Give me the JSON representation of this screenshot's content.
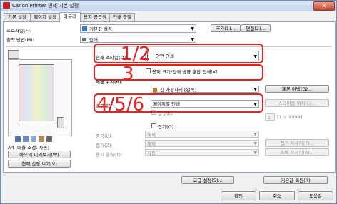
{
  "window": {
    "title": "Canon Printer 인쇄 기본 설정",
    "close_glyph": "✕"
  },
  "tabs": [
    {
      "label": "기본 설정"
    },
    {
      "label": "페이지 설정"
    },
    {
      "label": "마무리"
    },
    {
      "label": "용지 공급원"
    },
    {
      "label": "인쇄 품질"
    }
  ],
  "profile": {
    "label": "프로파일(F):",
    "value": "기본값 설정",
    "add_button": "추가(1)...",
    "edit_button": "편집(2)..."
  },
  "output": {
    "label": "출력 방법(M):",
    "value": "인쇄"
  },
  "preview": {
    "caption": "A4 [배율 조정: 자동]",
    "page_preview_button": "마무리 미리보기(W)",
    "view_settings_button": "현재 설정 보기(V)"
  },
  "print_style": {
    "label": "인쇄 스타일(Q):",
    "value": "양면 인쇄"
  },
  "mixed_sizes": {
    "label": "용지 크기/인쇄 방향 혼합 인쇄(X)"
  },
  "binding": {
    "label": "제본 위치(B):",
    "value": "긴 가장자리 [왼쪽]",
    "button": "제본 여백(G)..."
  },
  "finishing": {
    "label": "마무리(F):",
    "value": "페이지별 인쇄",
    "staple_button": "스테이플 위치(L)...",
    "offset_label": "옵셋(E)",
    "offset_range": "[1 ~ 9999]",
    "offset_value": "1"
  },
  "fold": {
    "label": "접기(O)",
    "collate_label": "중공(C):",
    "collate_value": "해제",
    "fold_label": "접기(Z):",
    "fold_value": "해제",
    "fold_button": "접기 자세히(7)...",
    "stack_label": "용지 출력(T):",
    "stack_value": "자동",
    "stack_button": "스택 자세히(8)..."
  },
  "bottom": {
    "advanced_button": "고급 설정(5)...",
    "restore_button": "기본값 복원(R)",
    "ok": "확인",
    "cancel": "취소",
    "help": "도움말"
  },
  "annotations": {
    "a1": "1/2",
    "a2": "3",
    "a3": "4/5/6"
  }
}
